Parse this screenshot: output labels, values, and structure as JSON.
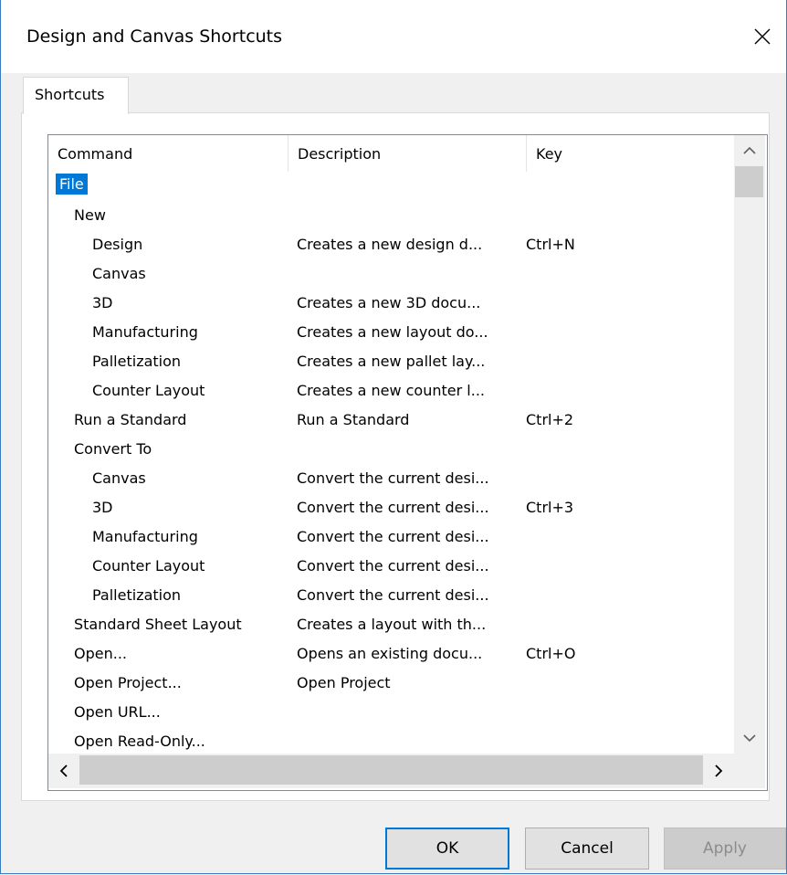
{
  "window": {
    "title": "Design and Canvas Shortcuts",
    "close_icon": "close-icon"
  },
  "tabs": [
    {
      "label": "Shortcuts",
      "selected": true
    }
  ],
  "list": {
    "columns": [
      "Command",
      "Description",
      "Key"
    ],
    "rows": [
      {
        "command": "File",
        "description": "",
        "key": "",
        "level": 0,
        "selected": true
      },
      {
        "command": "New",
        "description": "",
        "key": "",
        "level": 1
      },
      {
        "command": "Design",
        "description": "Creates a new design d...",
        "key": "Ctrl+N",
        "level": 2
      },
      {
        "command": "Canvas",
        "description": "",
        "key": "",
        "level": 2
      },
      {
        "command": "3D",
        "description": "Creates a new 3D docu...",
        "key": "",
        "level": 2
      },
      {
        "command": "Manufacturing",
        "description": "Creates a new layout do...",
        "key": "",
        "level": 2
      },
      {
        "command": "Palletization",
        "description": "Creates a new pallet lay...",
        "key": "",
        "level": 2
      },
      {
        "command": "Counter Layout",
        "description": "Creates a new counter l...",
        "key": "",
        "level": 2
      },
      {
        "command": "Run a Standard",
        "description": "Run a Standard",
        "key": "Ctrl+2",
        "level": 1
      },
      {
        "command": "Convert To",
        "description": "",
        "key": "",
        "level": 1
      },
      {
        "command": "Canvas",
        "description": "Convert the current desi...",
        "key": "",
        "level": 2
      },
      {
        "command": "3D",
        "description": "Convert the current desi...",
        "key": "Ctrl+3",
        "level": 2
      },
      {
        "command": "Manufacturing",
        "description": "Convert the current desi...",
        "key": "",
        "level": 2
      },
      {
        "command": "Counter Layout",
        "description": "Convert the current desi...",
        "key": "",
        "level": 2
      },
      {
        "command": "Palletization",
        "description": "Convert the current desi...",
        "key": "",
        "level": 2
      },
      {
        "command": "Standard Sheet Layout",
        "description": "Creates a layout with th...",
        "key": "",
        "level": 1
      },
      {
        "command": "Open...",
        "description": "Opens an existing docu...",
        "key": "Ctrl+O",
        "level": 1
      },
      {
        "command": "Open Project...",
        "description": "Open Project",
        "key": "",
        "level": 1
      },
      {
        "command": "Open URL...",
        "description": "",
        "key": "",
        "level": 1
      },
      {
        "command": "Open Read-Only...",
        "description": "",
        "key": "",
        "level": 1
      }
    ]
  },
  "buttons": {
    "ok": "OK",
    "cancel": "Cancel",
    "apply": "Apply"
  },
  "colors": {
    "selection": "#0078d7",
    "window_border": "#3b7bbf",
    "disabled_text": "#8c8c8c"
  }
}
